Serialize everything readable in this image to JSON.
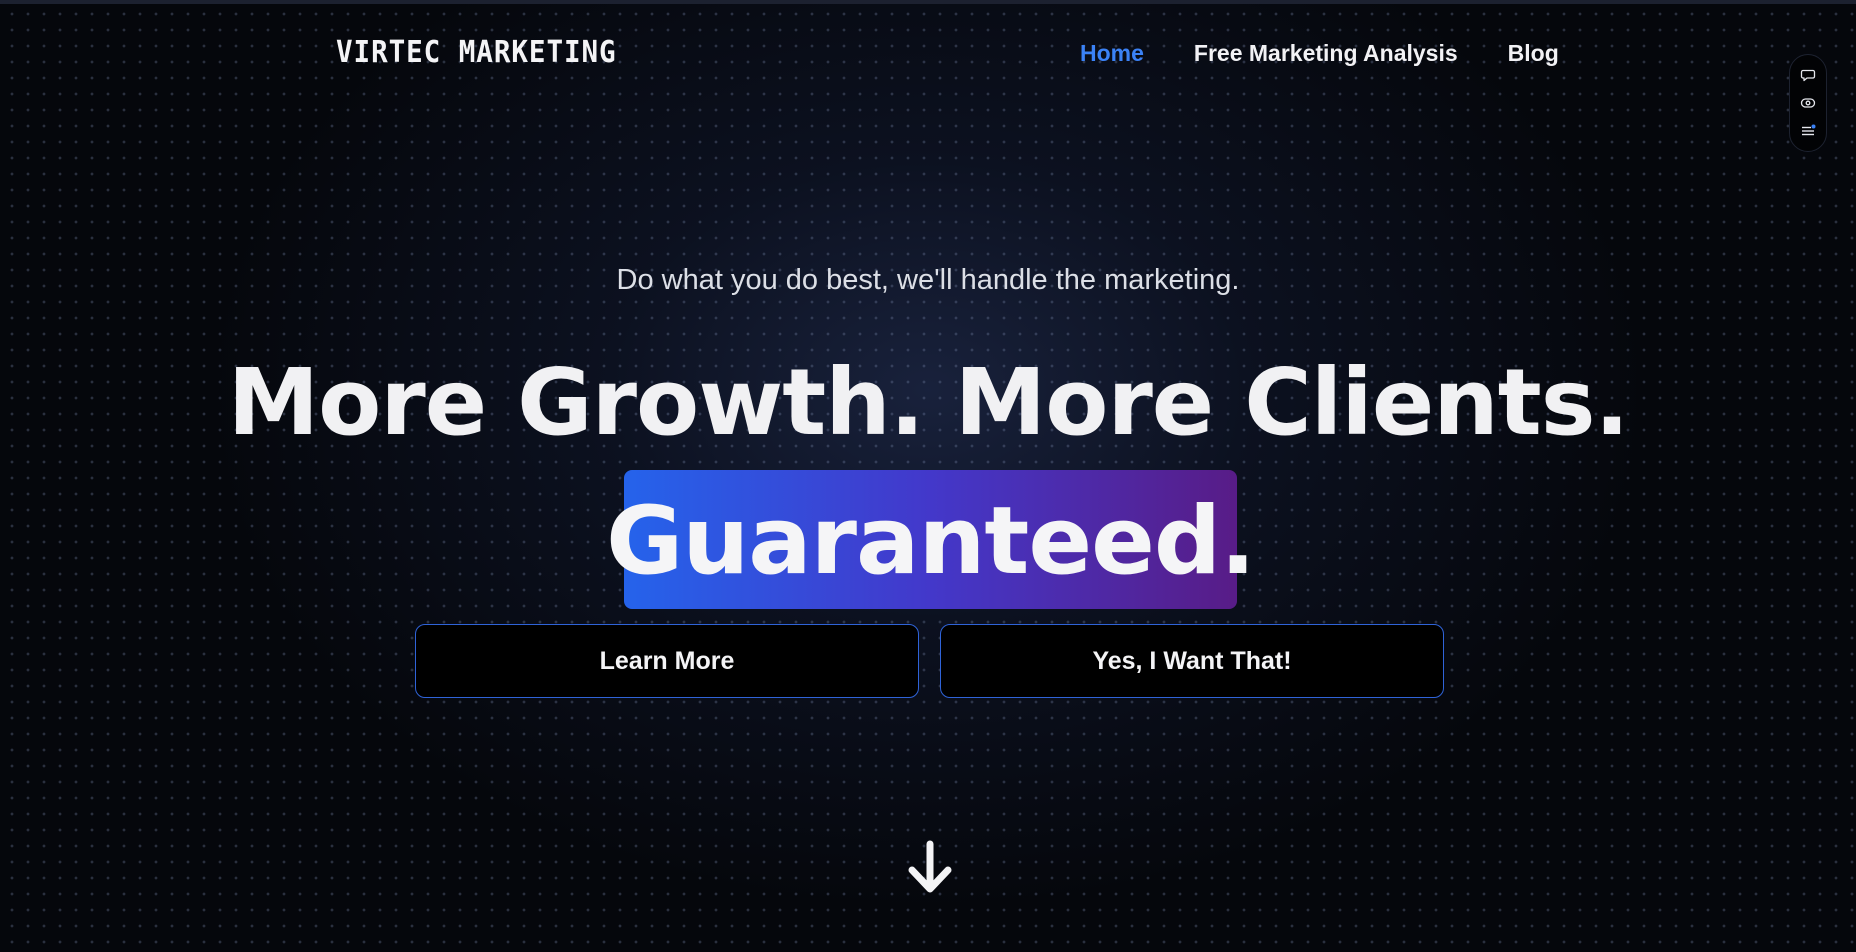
{
  "header": {
    "logo_text": "VIRTEC MARKETING",
    "nav": [
      {
        "label": "Home",
        "active": true
      },
      {
        "label": "Free Marketing Analysis",
        "active": false
      },
      {
        "label": "Blog",
        "active": false
      }
    ]
  },
  "widget": {
    "icons": [
      "chat-icon",
      "eye-icon",
      "menu-icon"
    ]
  },
  "hero": {
    "tagline": "Do what you do best, we'll handle the marketing.",
    "headline": "More Growth. More Clients.",
    "highlight": "Guaranteed.",
    "buttons": {
      "learn_more": "Learn More",
      "yes_want": "Yes, I Want That!"
    }
  },
  "colors": {
    "accent_blue": "#3b82f6",
    "gradient_start": "#2563eb",
    "gradient_end": "#581c87",
    "background": "#05070c"
  }
}
